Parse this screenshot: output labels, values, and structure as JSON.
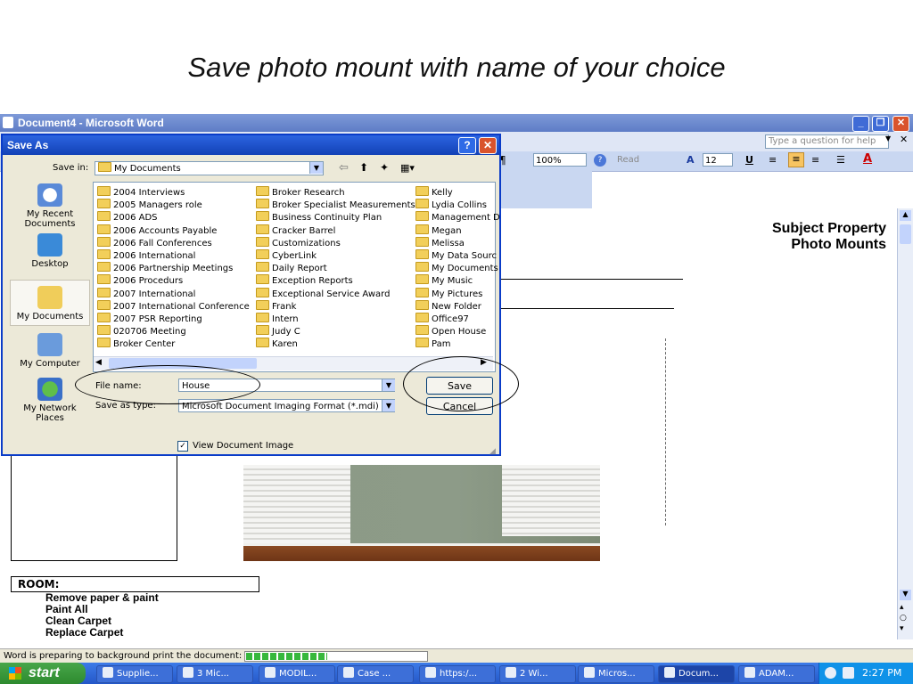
{
  "slide": {
    "title": "Save photo mount with name of your choice"
  },
  "word": {
    "title": "Document4 - Microsoft Word",
    "help_placeholder": "Type a question for help",
    "zoom": "100%",
    "read_label": "Read",
    "font_size": "12",
    "subject_line1": "Subject Property",
    "subject_line2": "Photo Mounts",
    "room_label": "ROOM:",
    "room_items": [
      "Remove paper & paint",
      "Paint All",
      "Clean Carpet",
      "Replace Carpet"
    ],
    "status_text": "Word is preparing to background print the document:",
    "print_progress": 0.45
  },
  "dialog": {
    "title": "Save As",
    "save_in_label": "Save in:",
    "save_in_value": "My Documents",
    "places": [
      "My Recent Documents",
      "Desktop",
      "My Documents",
      "My Computer",
      "My Network Places"
    ],
    "places_active": 2,
    "files_col1": [
      "2004 Interviews",
      "2005 Managers role",
      "2006 ADS",
      "2006 Accounts Payable",
      "2006 Fall Conferences",
      "2006 International",
      "2006 Partnership Meetings",
      "2006 Procedurs",
      "2007 International",
      "2007 International Conference",
      "2007 PSR Reporting",
      "020706 Meeting",
      "Broker Center"
    ],
    "files_col2": [
      "Broker Research",
      "Broker Specialist Measurements",
      "Business Continuity Plan",
      "Cracker Barrel",
      "Customizations",
      "CyberLink",
      "Daily Report",
      "Exception Reports",
      "Exceptional Service Award",
      "Frank",
      "Intern",
      "Judy C",
      "Karen"
    ],
    "files_col3": [
      "Kelly",
      "Lydia Collins",
      "Management D",
      "Megan",
      "Melissa",
      "My Data Sourc",
      "My Documents",
      "My Music",
      "My Pictures",
      "New Folder",
      "Office97",
      "Open House",
      "Pam"
    ],
    "file_name_label": "File name:",
    "file_name_value": "House",
    "save_as_type_label": "Save as type:",
    "save_as_type_value": "Microsoft Document Imaging Format (*.mdi)",
    "save_button": "Save",
    "cancel_button": "Cancel",
    "view_doc_image": "View Document Image",
    "view_doc_image_checked": true
  },
  "taskbar": {
    "start": "start",
    "tasks": [
      "Supplie...",
      "3 Mic...",
      "MODIL...",
      "Case ...",
      "https:/...",
      "2 Wi...",
      "Micros...",
      "Docum...",
      "ADAM..."
    ],
    "active_task": 7,
    "clock": "2:27 PM"
  }
}
